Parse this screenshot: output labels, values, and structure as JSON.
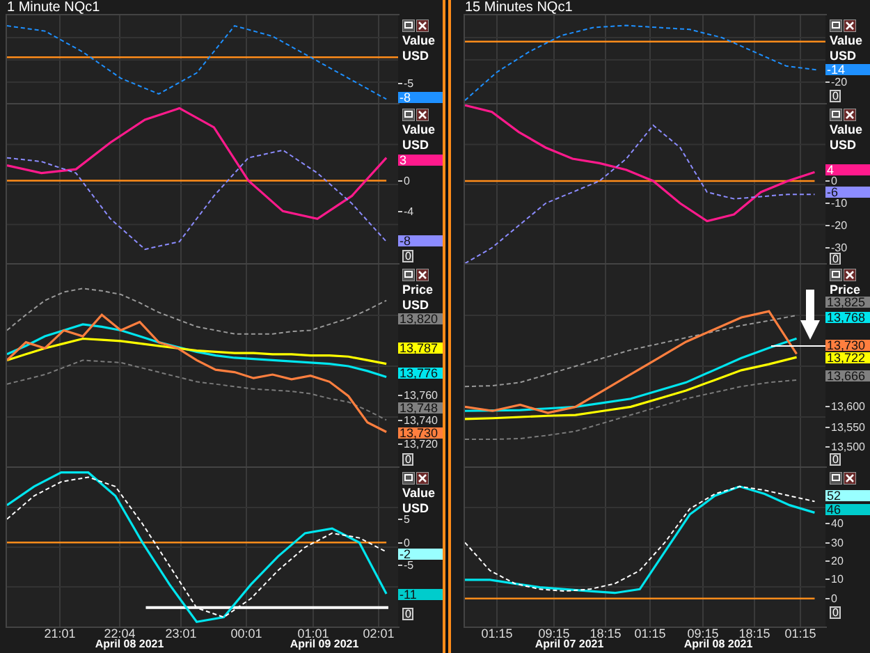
{
  "windows": [
    {
      "title": "1 Minute NQc1",
      "panes": [
        {
          "labels": [
            "Value",
            "USD"
          ],
          "axis_ticks": [
            "-5"
          ],
          "badges": [
            {
              "text": "-8",
              "color": "#1e90ff"
            }
          ]
        },
        {
          "labels": [
            "Value",
            "USD"
          ],
          "badges": [
            {
              "text": "3",
              "color": "#ff1a8c"
            },
            {
              "text": "-8",
              "color": "#8c8cff"
            }
          ],
          "zero_button": "0",
          "chart_data": {
            "type": "line",
            "ylim": [
              -11,
              10
            ],
            "yticks": [
              {
                "value": 0,
                "label": "0"
              },
              {
                "value": -4,
                "label": "-4"
              }
            ],
            "series": [
              {
                "color": "#ff8c1a",
                "line_style": "solid",
                "values": [
                  0,
                  0,
                  0,
                  0,
                  0,
                  0,
                  0,
                  0,
                  0,
                  0,
                  0,
                  0
                ]
              },
              {
                "color": "#ff1a8c",
                "line_style": "solid",
                "values": [
                  2,
                  1,
                  1.5,
                  5,
                  8,
                  9.5,
                  7,
                  0,
                  -4,
                  -5,
                  -2,
                  3
                ]
              },
              {
                "color": "#8c8cff",
                "line_style": "dashed",
                "values": [
                  3,
                  2.5,
                  1,
                  -5,
                  -9,
                  -8,
                  -2,
                  3,
                  4,
                  1,
                  -3,
                  -8
                ]
              }
            ]
          }
        },
        {
          "labels": [
            "Price",
            "USD"
          ],
          "badges": [
            {
              "text": "13,820",
              "color": "#808080"
            },
            {
              "text": "13,787",
              "color": "#ffff00"
            },
            {
              "text": "13,776",
              "color": "#00e5ee"
            },
            {
              "text": "13,748",
              "color": "#808080"
            },
            {
              "text": "13,730",
              "color": "#ff7f3f"
            }
          ],
          "zero_button": "0",
          "chart_data": {
            "type": "line",
            "ylim": [
              13700,
              13870
            ],
            "yticks": [
              {
                "value": 13760,
                "label": "13,760"
              },
              {
                "value": 13740,
                "label": "13,740"
              },
              {
                "value": 13720,
                "label": "13,720"
              }
            ],
            "series": [
              {
                "color": "#999999",
                "line_style": "dashed",
                "values": [
                  13815,
                  13828,
                  13840,
                  13847,
                  13850,
                  13848,
                  13845,
                  13838,
                  13830,
                  13824,
                  13818,
                  13815,
                  13812,
                  13812,
                  13812,
                  13814,
                  13815,
                  13820,
                  13825,
                  13832,
                  13840
                ]
              },
              {
                "color": "#7a7a7a",
                "line_style": "dashed",
                "values": [
                  13770,
                  13774,
                  13778,
                  13784,
                  13790,
                  13789,
                  13788,
                  13784,
                  13780,
                  13776,
                  13772,
                  13770,
                  13768,
                  13766,
                  13765,
                  13764,
                  13762,
                  13758,
                  13755,
                  13748,
                  13740
                ]
              },
              {
                "color": "#00e5ee",
                "line_style": "solid",
                "values": [
                  13795,
                  13802,
                  13810,
                  13815,
                  13820,
                  13818,
                  13815,
                  13810,
                  13805,
                  13801,
                  13797,
                  13794,
                  13792,
                  13791,
                  13790,
                  13789,
                  13788,
                  13787,
                  13785,
                  13781,
                  13776
                ]
              },
              {
                "color": "#ffff00",
                "line_style": "solid",
                "values": [
                  13790,
                  13795,
                  13800,
                  13804,
                  13808,
                  13807,
                  13806,
                  13804,
                  13802,
                  13800,
                  13798,
                  13797,
                  13796,
                  13796,
                  13795,
                  13795,
                  13794,
                  13794,
                  13793,
                  13790,
                  13787
                ]
              },
              {
                "color": "#ff7f3f",
                "line_style": "solid",
                "values": [
                  13790,
                  13805,
                  13800,
                  13815,
                  13810,
                  13828,
                  13815,
                  13822,
                  13805,
                  13800,
                  13790,
                  13782,
                  13780,
                  13775,
                  13778,
                  13774,
                  13777,
                  13772,
                  13760,
                  13738,
                  13730
                ]
              }
            ]
          }
        },
        {
          "labels": [
            "Value",
            "USD"
          ],
          "badges": [
            {
              "text": "-2",
              "color": "#99ffff"
            },
            {
              "text": "-11",
              "color": "#00cccc"
            }
          ],
          "zero_button": "0",
          "chart_data": {
            "type": "line",
            "ylim": [
              -18,
              16
            ],
            "yticks": [
              {
                "value": 5,
                "label": "5"
              },
              {
                "value": 0,
                "label": "0"
              },
              {
                "value": -5,
                "label": "-5"
              }
            ],
            "series": [
              {
                "color": "#ff8c1a",
                "line_style": "solid",
                "values": [
                  0,
                  0,
                  0,
                  0,
                  0,
                  0,
                  0,
                  0,
                  0,
                  0,
                  0,
                  0,
                  0,
                  0,
                  0
                ]
              },
              {
                "color": "#00e5ee",
                "line_style": "solid",
                "values": [
                  8,
                  12,
                  15,
                  15,
                  10,
                  0,
                  -9,
                  -17,
                  -16,
                  -9,
                  -3,
                  2,
                  3,
                  0,
                  -11
                ]
              },
              {
                "color": "#ffffff",
                "line_style": "dashed",
                "values": [
                  5,
                  10,
                  13,
                  14,
                  12,
                  4,
                  -5,
                  -14,
                  -16,
                  -12,
                  -6,
                  -1,
                  2,
                  1,
                  -2
                ]
              }
            ]
          }
        }
      ],
      "time_ticks": [
        "21:01",
        "22:04",
        "23:01",
        "00:01",
        "01:01",
        "02:01"
      ],
      "dates": [
        "April 08 2021",
        "April 09 2021"
      ]
    },
    {
      "title": "15 Minutes NQc1",
      "panes": [
        {
          "labels": [
            "Value",
            "USD"
          ],
          "axis_ticks": [
            "-20"
          ],
          "badges": [
            {
              "text": "-14",
              "color": "#1e90ff"
            }
          ],
          "zero_button": "0"
        },
        {
          "labels": [
            "Value",
            "USD"
          ],
          "badges": [
            {
              "text": "4",
              "color": "#ff1a8c"
            },
            {
              "text": "-6",
              "color": "#8c8cff"
            }
          ],
          "zero_button": "0",
          "chart_data": {
            "type": "line",
            "ylim": [
              -37.5,
              34.375
            ],
            "yticks": [
              {
                "value": 0,
                "label": "0"
              },
              {
                "value": -10,
                "label": "-10"
              },
              {
                "value": -20,
                "label": "-20"
              },
              {
                "value": -30,
                "label": "-30"
              }
            ],
            "series": [
              {
                "color": "#ff8c1a",
                "line_style": "solid",
                "values": [
                  0,
                  0,
                  0,
                  0,
                  0,
                  0,
                  0,
                  0,
                  0,
                  0,
                  0,
                  0,
                  0,
                  0
                ]
              },
              {
                "color": "#ff1a8c",
                "line_style": "solid",
                "values": [
                  34,
                  31,
                  22,
                  15,
                  10,
                  8,
                  5,
                  0,
                  -10,
                  -18,
                  -15,
                  -5,
                  0,
                  4
                ]
              },
              {
                "color": "#8c8cff",
                "line_style": "dashed",
                "values": [
                  -37,
                  -30,
                  -20,
                  -10,
                  -5,
                  0,
                  10,
                  25,
                  15,
                  -5,
                  -8,
                  -7,
                  -6,
                  -6
                ]
              }
            ]
          }
        },
        {
          "labels": [
            "Price"
          ],
          "badges": [
            {
              "text": "13,825",
              "color": "#808080"
            },
            {
              "text": "13,768",
              "color": "#00e5ee"
            },
            {
              "text": "13,730",
              "color": "#ff7f3f"
            },
            {
              "text": "13,722",
              "color": "#ffff00"
            },
            {
              "text": "13,666",
              "color": "#808080"
            }
          ],
          "zero_button": "0",
          "chart_data": {
            "type": "line",
            "ylim": [
              13450,
              13950
            ],
            "yticks": [
              {
                "value": 13600,
                "label": "13,600"
              },
              {
                "value": 13550,
                "label": "13,550"
              },
              {
                "value": 13500,
                "label": "13,500"
              }
            ],
            "series": [
              {
                "color": "#999999",
                "line_style": "dashed",
                "values": [
                  13650,
                  13652,
                  13660,
                  13680,
                  13700,
                  13720,
                  13740,
                  13755,
                  13770,
                  13785,
                  13800,
                  13812,
                  13825
                ]
              },
              {
                "color": "#7a7a7a",
                "line_style": "dashed",
                "values": [
                  13520,
                  13520,
                  13522,
                  13530,
                  13540,
                  13560,
                  13580,
                  13600,
                  13620,
                  13635,
                  13650,
                  13660,
                  13666
                ]
              },
              {
                "color": "#00e5ee",
                "line_style": "solid",
                "values": [
                  13590,
                  13591,
                  13592,
                  13596,
                  13600,
                  13610,
                  13620,
                  13640,
                  13660,
                  13690,
                  13720,
                  13745,
                  13768
                ]
              },
              {
                "color": "#ffff00",
                "line_style": "solid",
                "values": [
                  13570,
                  13572,
                  13575,
                  13578,
                  13580,
                  13590,
                  13600,
                  13620,
                  13640,
                  13665,
                  13690,
                  13705,
                  13722
                ]
              },
              {
                "color": "#ff7f3f",
                "line_style": "solid",
                "values": [
                  13600,
                  13590,
                  13605,
                  13585,
                  13600,
                  13640,
                  13680,
                  13720,
                  13760,
                  13790,
                  13820,
                  13835,
                  13730
                ]
              }
            ]
          }
        },
        {
          "badges": [
            {
              "text": "52",
              "color": "#99ffff"
            },
            {
              "text": "46",
              "color": "#00cccc"
            }
          ],
          "zero_button": "0",
          "chart_data": {
            "type": "line",
            "ylim": [
              -15,
              70
            ],
            "yticks": [
              {
                "value": 40,
                "label": "40"
              },
              {
                "value": 30,
                "label": "30"
              },
              {
                "value": 20,
                "label": "20"
              },
              {
                "value": 10,
                "label": "10"
              },
              {
                "value": 0,
                "label": "0"
              }
            ],
            "series": [
              {
                "color": "#ff8c1a",
                "line_style": "solid",
                "values": [
                  0,
                  0,
                  0,
                  0,
                  0,
                  0,
                  0,
                  0,
                  0,
                  0,
                  0,
                  0,
                  0,
                  0,
                  0
                ]
              },
              {
                "color": "#00e5ee",
                "line_style": "solid",
                "values": [
                  10,
                  10,
                  8,
                  6,
                  5,
                  4,
                  3,
                  5,
                  25,
                  45,
                  55,
                  60,
                  56,
                  50,
                  46
                ]
              },
              {
                "color": "#ffffff",
                "line_style": "dashed",
                "values": [
                  30,
                  15,
                  8,
                  5,
                  4,
                  5,
                  8,
                  15,
                  30,
                  48,
                  56,
                  60,
                  58,
                  55,
                  52
                ]
              }
            ]
          }
        }
      ],
      "time_ticks": [
        "01:15",
        "09:15",
        "18:15",
        "01:15",
        "09:15",
        "18:15",
        "01:15"
      ],
      "dates": [
        "April 07 2021",
        "April 08 2021"
      ]
    }
  ]
}
